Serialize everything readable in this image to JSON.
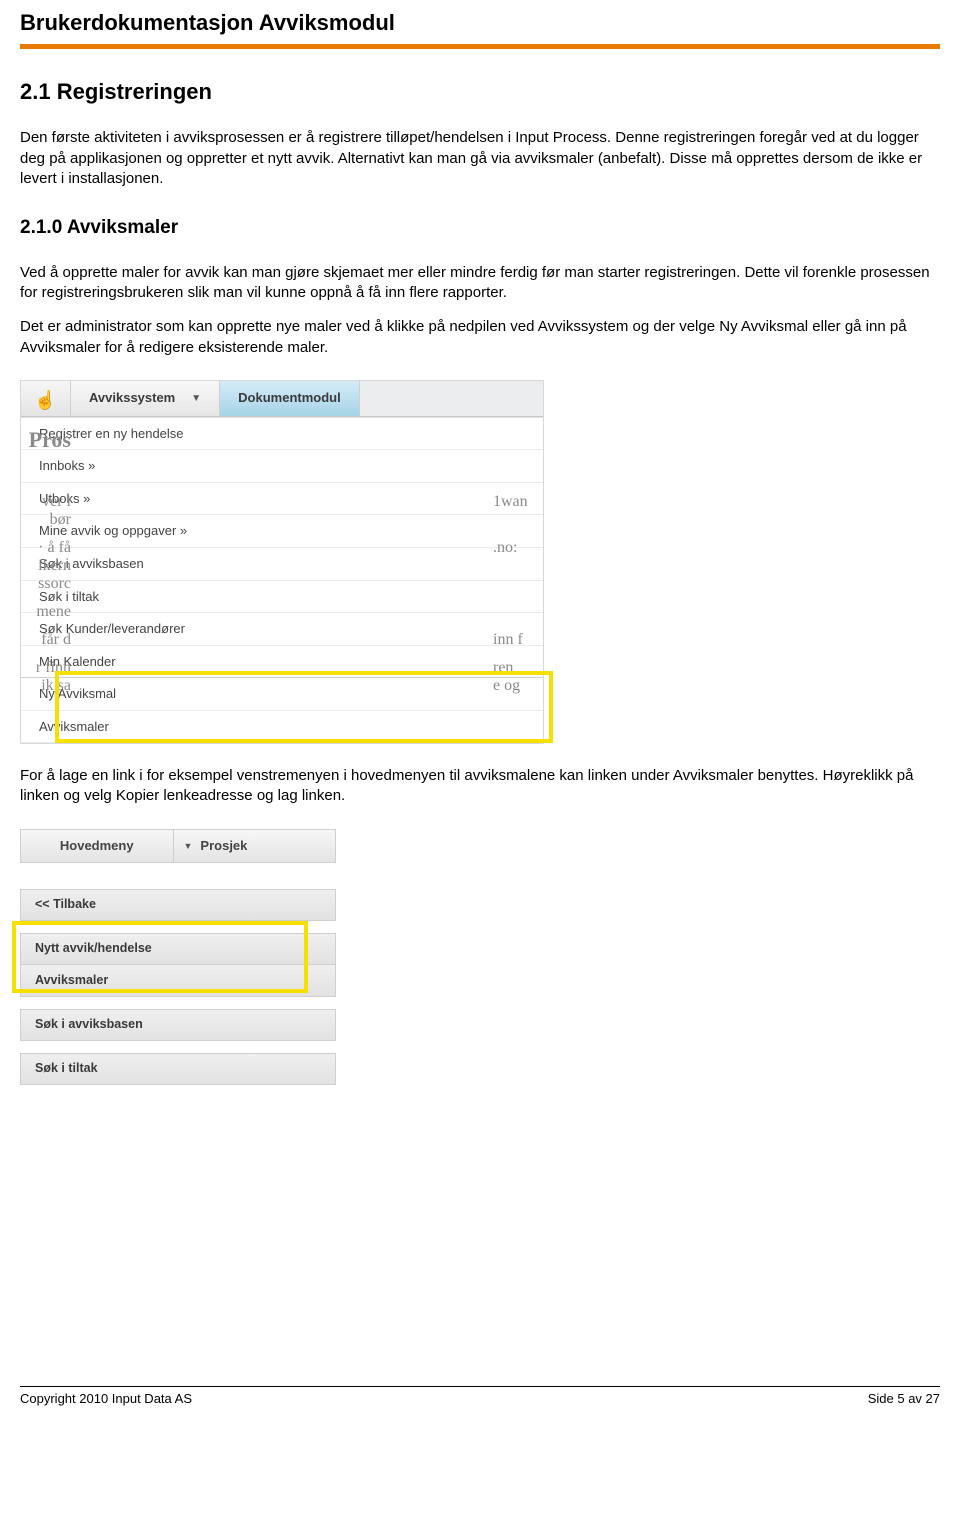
{
  "doc_title": "Brukerdokumentasjon Avviksmodul",
  "section21": {
    "heading": "2.1 Registreringen",
    "p1": "Den første aktiviteten i avviksprosessen er å registrere tilløpet/hendelsen i Input Process. Denne registreringen foregår ved at du logger deg på applikasjonen og oppretter et nytt avvik. Alternativt kan man gå via avviksmaler (anbefalt). Disse må opprettes dersom de ikke er levert i installasjonen."
  },
  "section210": {
    "heading": "2.1.0 Avviksmaler",
    "p1": "Ved å opprette maler for avvik kan man gjøre skjemaet mer eller mindre ferdig før man starter registreringen. Dette vil forenkle prosessen for registreringsbrukeren slik man vil kunne oppnå å få inn flere rapporter.",
    "p2": "Det er administrator som kan opprette nye maler ved å klikke på nedpilen ved Avvikssystem og der velge Ny Avviksmal eller gå inn på Avviksmaler for å redigere eksisterende maler."
  },
  "shot1": {
    "tabs": {
      "avvik": "Avvikssystem",
      "dok": "Dokumentmodul"
    },
    "menu": [
      "Registrer en ny hendelse",
      "Innboks »",
      "Utboks »",
      "Mine avvik og oppgaver »",
      "Søk i avviksbasen",
      "Søk i tiltak",
      "Søk Kunder/leverandører",
      "Min Kalender",
      "Ny Avviksmal",
      "Avviksmaler"
    ],
    "left_frag": [
      "Pros",
      "ver i",
      " bør",
      "· å få",
      "ikern",
      "ssorc",
      "mene",
      " får d",
      "r finn",
      "ik sa"
    ],
    "right_frag": [
      "1wan",
      ".no:",
      "inn f",
      "ren",
      "e og"
    ]
  },
  "para_mid": "For å lage en link i for eksempel venstremenyen i hovedmenyen til avviksmalene kan linken under Avviksmaler benyttes. Høyreklikk på linken og velg Kopier lenkeadresse og lag linken.",
  "shot2": {
    "top": {
      "hoved": "Hovedmeny",
      "prosj": "Prosjek"
    },
    "items": [
      "<< Tilbake",
      "Nytt avvik/hendelse",
      "Avviksmaler",
      "Søk i avviksbasen",
      "Søk i tiltak"
    ]
  },
  "footer": {
    "left": "Copyright 2010 Input Data AS",
    "right": "Side 5 av 27"
  }
}
